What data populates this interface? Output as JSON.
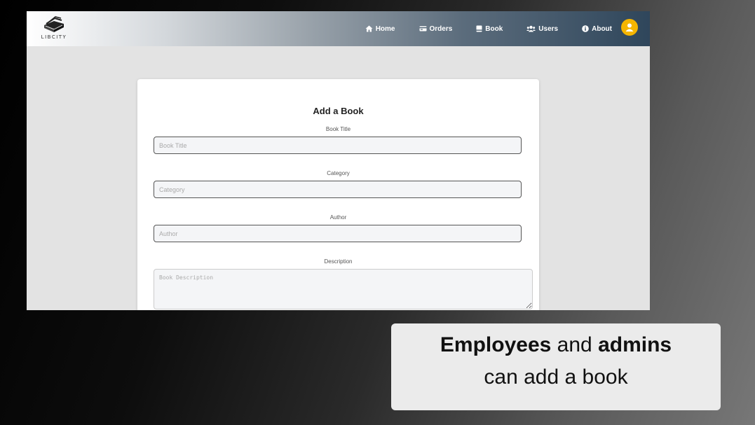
{
  "app": {
    "logo_text": "LIBCITY"
  },
  "nav": {
    "items": [
      {
        "label": "Home",
        "icon": "home-icon"
      },
      {
        "label": "Orders",
        "icon": "card-icon"
      },
      {
        "label": "Book",
        "icon": "book-icon"
      },
      {
        "label": "Users",
        "icon": "users-icon"
      },
      {
        "label": "About",
        "icon": "info-icon"
      }
    ],
    "avatar_icon": "user-icon",
    "avatar_color": "#f5b500"
  },
  "form": {
    "title": "Add a Book",
    "fields": [
      {
        "label": "Book Title",
        "placeholder": "Book Title",
        "value": ""
      },
      {
        "label": "Category",
        "placeholder": "Category",
        "value": ""
      },
      {
        "label": "Author",
        "placeholder": "Author",
        "value": ""
      },
      {
        "label": "Description",
        "placeholder": "Book Description",
        "value": ""
      }
    ]
  },
  "caption": {
    "word1": "Employees",
    "word2": " and ",
    "word3": "admins",
    "line2": "can add a book"
  }
}
